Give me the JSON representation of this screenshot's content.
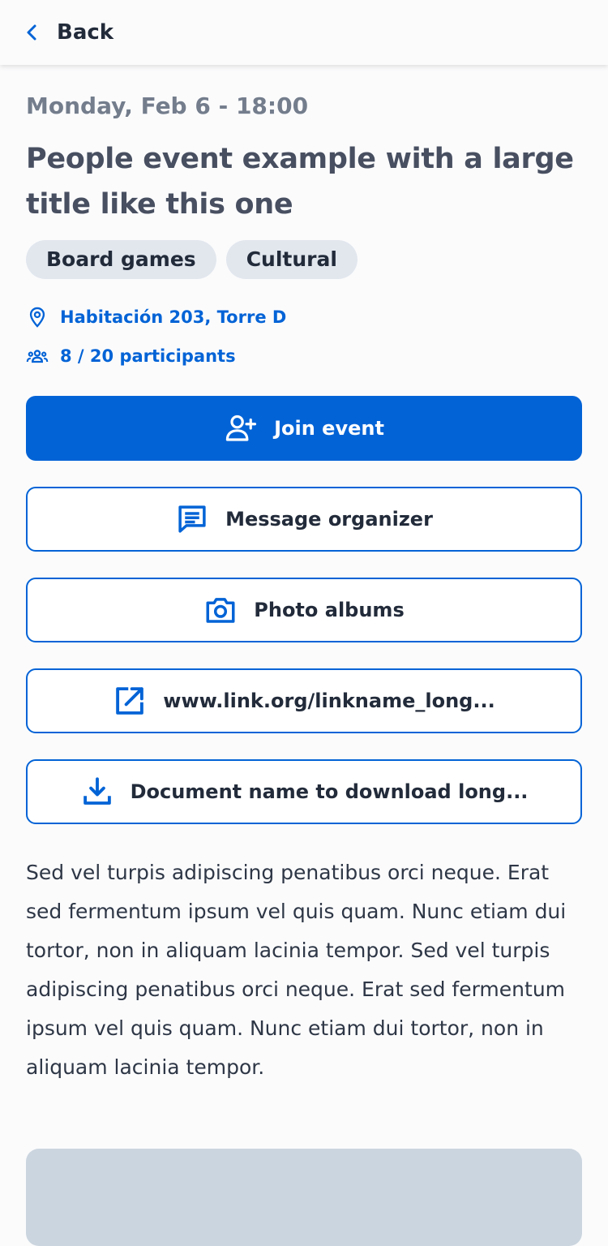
{
  "header": {
    "back_label": "Back",
    "back_icon": "chevron-left-icon"
  },
  "event": {
    "date": "Monday, Feb 6 - 18:00",
    "title": "People event example with a large title like this one",
    "tags": [
      "Board games",
      "Cultural"
    ],
    "location": "Habitación 203, Torre D",
    "participants": "8 / 20 participants"
  },
  "actions": {
    "join": "Join event",
    "message": "Message organizer",
    "photos": "Photo albums",
    "link": "www.link.org/linkname_long...",
    "document": "Document name to download long..."
  },
  "description": "Sed vel turpis adipiscing penatibus orci neque. Erat sed fermentum ipsum vel quis quam. Nunc etiam dui tortor, non in aliquam lacinia tempor. Sed vel turpis adipiscing penatibus orci neque. Erat sed fermentum ipsum vel quis quam. Nunc etiam dui tortor, non in aliquam lacinia tempor.",
  "colors": {
    "accent": "#0263d6",
    "tag_bg": "#e2e7ee",
    "text_dark": "#222b3a",
    "text_muted": "#737d8c",
    "placeholder": "#cbd5df"
  }
}
